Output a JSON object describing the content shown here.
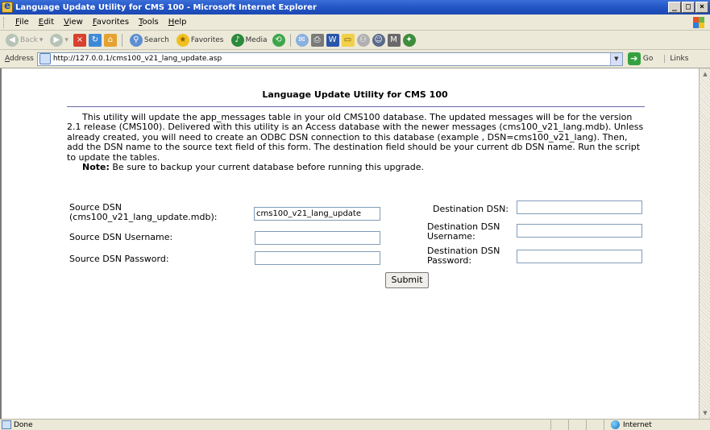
{
  "window": {
    "title": "Language Update Utility for CMS 100 - Microsoft Internet Explorer",
    "minimize": "_",
    "maximize": "□",
    "close": "×"
  },
  "menu": {
    "items": [
      "File",
      "Edit",
      "View",
      "Favorites",
      "Tools",
      "Help"
    ]
  },
  "toolbar": {
    "back": "Back",
    "search": "Search",
    "favorites": "Favorites",
    "media": "Media"
  },
  "address": {
    "label": "Address",
    "url": "http://127.0.0.1/cms100_v21_lang_update.asp",
    "go": "Go",
    "links": "Links"
  },
  "page": {
    "heading": "Language Update Utility for CMS 100",
    "intro": "This utility will update the app_messages table in your old CMS100 database. The updated messages will be for the version 2.1 release (CMS100). Delivered with this utility is an Access database with the newer messages (cms100_v21_lang.mdb). Unless already created, you will need to create an ODBC DSN connection to this database (example , DSN=cms100_v21_lang). Then, add the DSN name to the source text field of this form. The destination field should be your current db DSN name. Run the script to update the tables.",
    "note_label": "Note:",
    "note_text": " Be sure to backup your current database before running this upgrade."
  },
  "form": {
    "source_dsn_label_1": "Source DSN",
    "source_dsn_label_2": "(cms100_v21_lang_update.mdb):",
    "source_dsn_value": "cms100_v21_lang_update",
    "source_user_label": "Source DSN Username:",
    "source_user_value": "",
    "source_pass_label": "Source DSN Password:",
    "source_pass_value": "",
    "dest_dsn_label": "Destination DSN:",
    "dest_dsn_value": "",
    "dest_user_label_1": "Destination DSN",
    "dest_user_label_2": "Username:",
    "dest_user_value": "",
    "dest_pass_label_1": "Destination DSN",
    "dest_pass_label_2": "Password:",
    "dest_pass_value": "",
    "submit": "Submit"
  },
  "status": {
    "text": "Done",
    "zone": "Internet"
  }
}
